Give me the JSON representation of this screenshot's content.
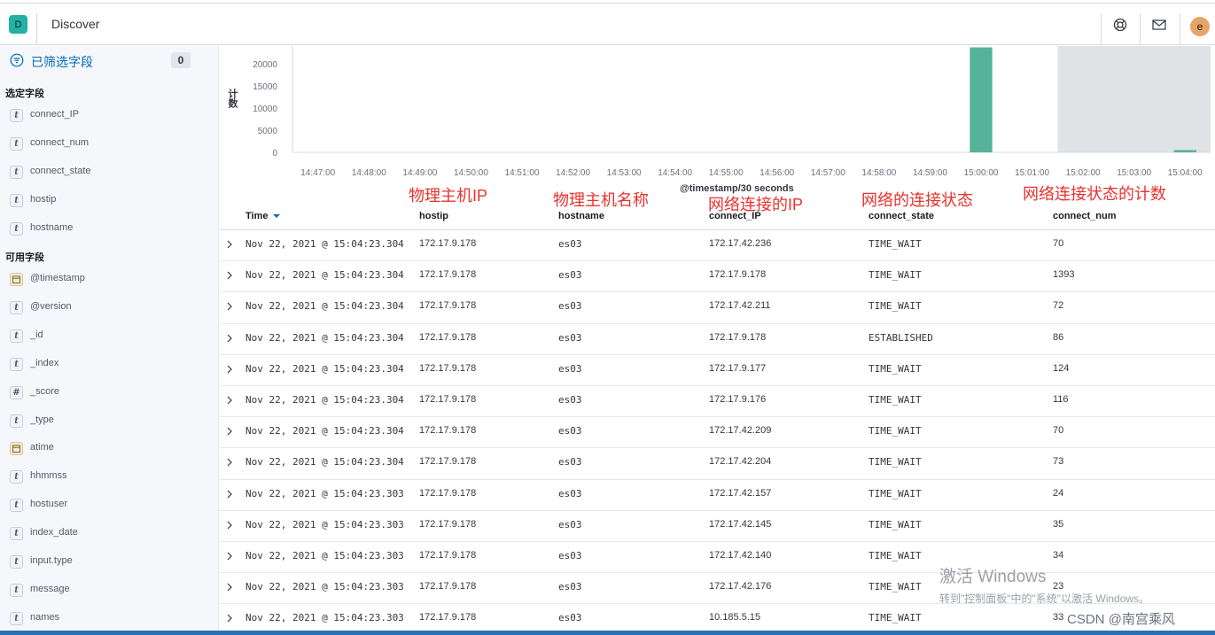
{
  "app": {
    "badge": "D",
    "title": "Discover",
    "avatar": "e"
  },
  "sidebar": {
    "filter_label": "已筛选字段",
    "filter_count": "0",
    "selected_title": "选定字段",
    "selected_fields": [
      {
        "type": "t",
        "name": "connect_IP"
      },
      {
        "type": "t",
        "name": "connect_num"
      },
      {
        "type": "t",
        "name": "connect_state"
      },
      {
        "type": "t",
        "name": "hostip"
      },
      {
        "type": "t",
        "name": "hostname"
      }
    ],
    "available_title": "可用字段",
    "available_fields": [
      {
        "type": "date",
        "name": "@timestamp"
      },
      {
        "type": "t",
        "name": "@version"
      },
      {
        "type": "t",
        "name": "_id"
      },
      {
        "type": "t",
        "name": "_index"
      },
      {
        "type": "#",
        "name": "_score"
      },
      {
        "type": "t",
        "name": "_type"
      },
      {
        "type": "date",
        "name": "atime"
      },
      {
        "type": "t",
        "name": "hhmmss"
      },
      {
        "type": "t",
        "name": "hostuser"
      },
      {
        "type": "t",
        "name": "index_date"
      },
      {
        "type": "t",
        "name": "input.type"
      },
      {
        "type": "t",
        "name": "message"
      },
      {
        "type": "t",
        "name": "names"
      }
    ]
  },
  "chart_data": {
    "type": "bar",
    "ylabel": "计数",
    "xlabel": "@timestamp/30 seconds",
    "yticks": [
      "0",
      "5000",
      "10000",
      "15000",
      "20000"
    ],
    "ylim": [
      0,
      24000
    ],
    "xticks": [
      "14:47:00",
      "14:48:00",
      "14:49:00",
      "14:50:00",
      "14:51:00",
      "14:52:00",
      "14:53:00",
      "14:54:00",
      "14:55:00",
      "14:56:00",
      "14:57:00",
      "14:58:00",
      "14:59:00",
      "15:00:00",
      "15:01:00",
      "15:02:00",
      "15:03:00",
      "15:04:00"
    ],
    "x_start": "14:46:30",
    "x_end": "15:04:30",
    "bars": [
      {
        "time": "15:00:00",
        "value": 23700
      },
      {
        "time": "15:04:00",
        "value": 500
      }
    ],
    "shaded_range": [
      "15:01:30",
      "15:04:30"
    ],
    "bar_color": "#54b399",
    "shade_color": "#e0e2e5"
  },
  "annotations": {
    "hostip": "物理主机IP",
    "hostname": "物理主机名称",
    "connect_IP": "网络连接的IP",
    "connect_state": "网络的连接状态",
    "connect_num": "网络连接状态的计数"
  },
  "table": {
    "headers": {
      "time": "Time",
      "hostip": "hostip",
      "hostname": "hostname",
      "connect_IP": "connect_IP",
      "connect_state": "connect_state",
      "connect_num": "connect_num"
    },
    "rows": [
      {
        "time": "Nov 22, 2021 @ 15:04:23.304",
        "hostip": "172.17.9.178",
        "hostname": "es03",
        "connect_IP": "172.17.42.236",
        "connect_state": "TIME_WAIT",
        "connect_num": "70"
      },
      {
        "time": "Nov 22, 2021 @ 15:04:23.304",
        "hostip": "172.17.9.178",
        "hostname": "es03",
        "connect_IP": "172.17.9.178",
        "connect_state": "TIME_WAIT",
        "connect_num": "1393"
      },
      {
        "time": "Nov 22, 2021 @ 15:04:23.304",
        "hostip": "172.17.9.178",
        "hostname": "es03",
        "connect_IP": "172.17.42.211",
        "connect_state": "TIME_WAIT",
        "connect_num": "72"
      },
      {
        "time": "Nov 22, 2021 @ 15:04:23.304",
        "hostip": "172.17.9.178",
        "hostname": "es03",
        "connect_IP": "172.17.9.178",
        "connect_state": "ESTABLISHED",
        "connect_num": "86"
      },
      {
        "time": "Nov 22, 2021 @ 15:04:23.304",
        "hostip": "172.17.9.178",
        "hostname": "es03",
        "connect_IP": "172.17.9.177",
        "connect_state": "TIME_WAIT",
        "connect_num": "124"
      },
      {
        "time": "Nov 22, 2021 @ 15:04:23.304",
        "hostip": "172.17.9.178",
        "hostname": "es03",
        "connect_IP": "172.17.9.176",
        "connect_state": "TIME_WAIT",
        "connect_num": "116"
      },
      {
        "time": "Nov 22, 2021 @ 15:04:23.304",
        "hostip": "172.17.9.178",
        "hostname": "es03",
        "connect_IP": "172.17.42.209",
        "connect_state": "TIME_WAIT",
        "connect_num": "70"
      },
      {
        "time": "Nov 22, 2021 @ 15:04:23.304",
        "hostip": "172.17.9.178",
        "hostname": "es03",
        "connect_IP": "172.17.42.204",
        "connect_state": "TIME_WAIT",
        "connect_num": "73"
      },
      {
        "time": "Nov 22, 2021 @ 15:04:23.303",
        "hostip": "172.17.9.178",
        "hostname": "es03",
        "connect_IP": "172.17.42.157",
        "connect_state": "TIME_WAIT",
        "connect_num": "24"
      },
      {
        "time": "Nov 22, 2021 @ 15:04:23.303",
        "hostip": "172.17.9.178",
        "hostname": "es03",
        "connect_IP": "172.17.42.145",
        "connect_state": "TIME_WAIT",
        "connect_num": "35"
      },
      {
        "time": "Nov 22, 2021 @ 15:04:23.303",
        "hostip": "172.17.9.178",
        "hostname": "es03",
        "connect_IP": "172.17.42.140",
        "connect_state": "TIME_WAIT",
        "connect_num": "34"
      },
      {
        "time": "Nov 22, 2021 @ 15:04:23.303",
        "hostip": "172.17.9.178",
        "hostname": "es03",
        "connect_IP": "172.17.42.176",
        "connect_state": "TIME_WAIT",
        "connect_num": "23"
      },
      {
        "time": "Nov 22, 2021 @ 15:04:23.303",
        "hostip": "172.17.9.178",
        "hostname": "es03",
        "connect_IP": "10.185.5.15",
        "connect_state": "TIME_WAIT",
        "connect_num": "33"
      }
    ]
  },
  "watermark": {
    "line1": "激活 Windows",
    "line2": "转到\"控制面板\"中的\"系统\"以激活 Windows。",
    "credit": "CSDN @南宫乘风"
  },
  "icons": {
    "help": "help-lifebuoy-icon",
    "mail": "mail-icon",
    "filter": "filter-icon",
    "sort": "sort-down-icon",
    "expand": "chevron-right-icon"
  }
}
